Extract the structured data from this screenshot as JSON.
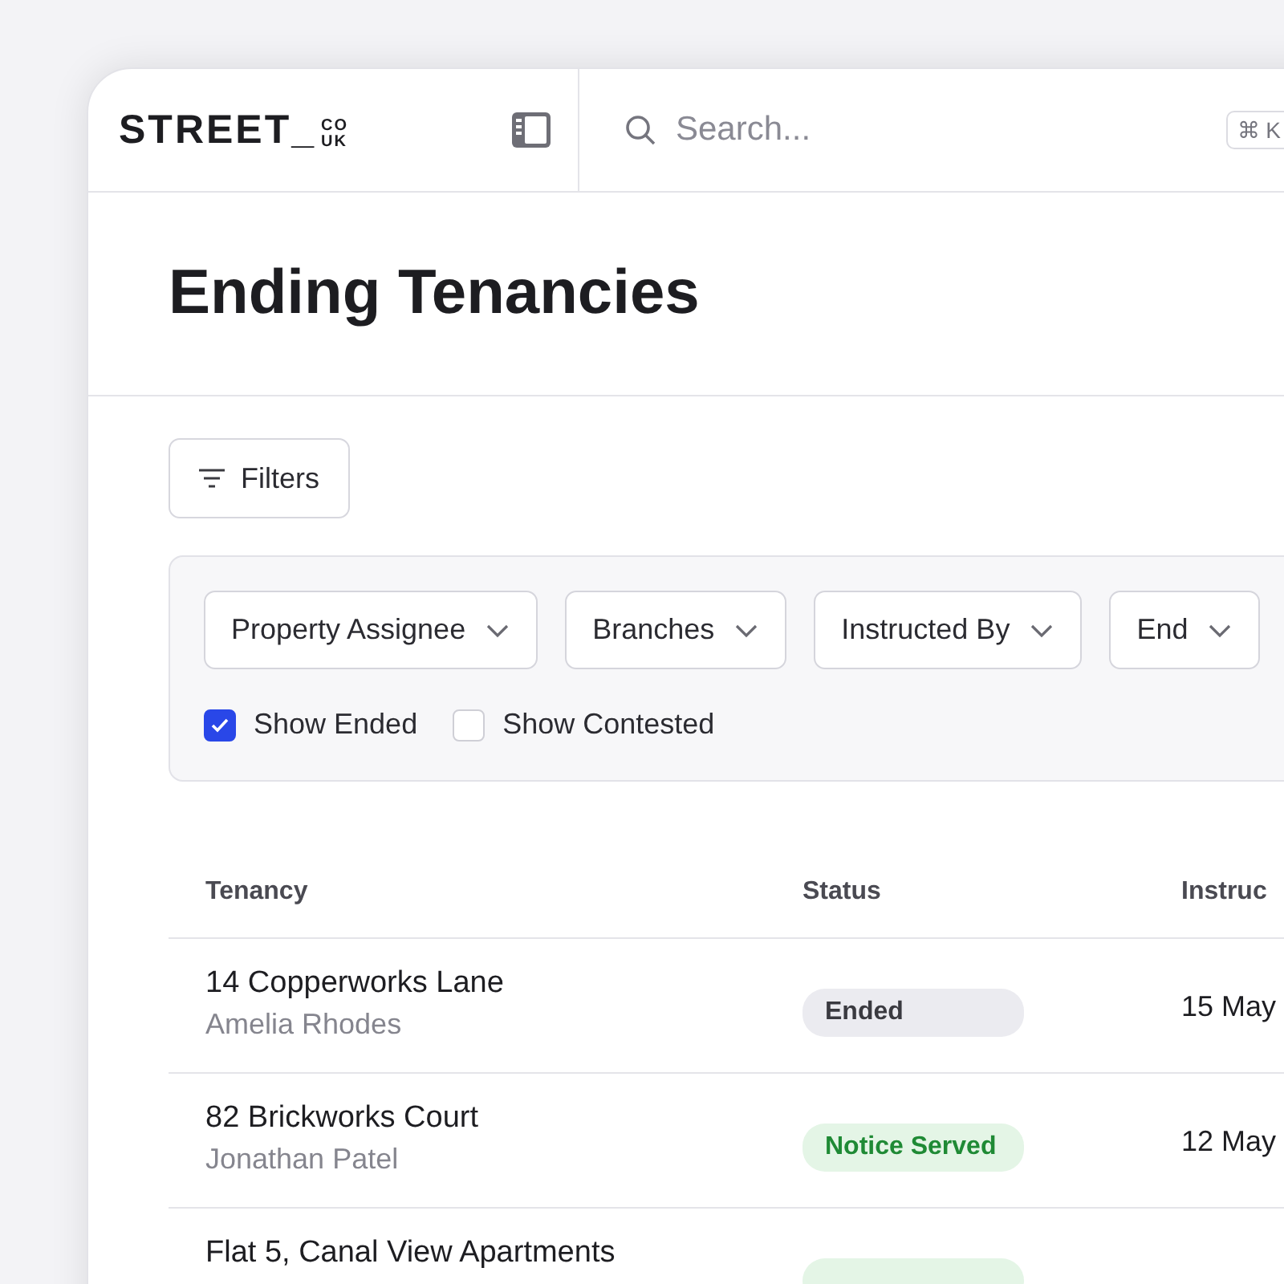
{
  "logo": {
    "name": "STREET_",
    "domain_top": "CO",
    "domain_bottom": "UK"
  },
  "search": {
    "placeholder": "Search...",
    "shortcut": "⌘ K"
  },
  "page": {
    "title": "Ending Tenancies"
  },
  "filters_button": {
    "label": "Filters"
  },
  "filter_dropdowns": [
    "Property Assignee",
    "Branches",
    "Instructed By",
    "End"
  ],
  "toggles": [
    {
      "label": "Show Ended",
      "checked": true
    },
    {
      "label": "Show Contested",
      "checked": false
    }
  ],
  "table": {
    "columns": [
      "Tenancy",
      "Status",
      "Instruc"
    ],
    "rows": [
      {
        "address": "14 Copperworks Lane",
        "tenant": "Amelia Rhodes",
        "status": {
          "label": "Ended",
          "kind": "ended"
        },
        "instructed": "15 May"
      },
      {
        "address": "82 Brickworks Court",
        "tenant": "Jonathan Patel",
        "status": {
          "label": "Notice Served",
          "kind": "notice"
        },
        "instructed": "12 May"
      },
      {
        "address": "Flat 5, Canal View Apartments",
        "status": {
          "kind": "notice"
        }
      }
    ]
  }
}
